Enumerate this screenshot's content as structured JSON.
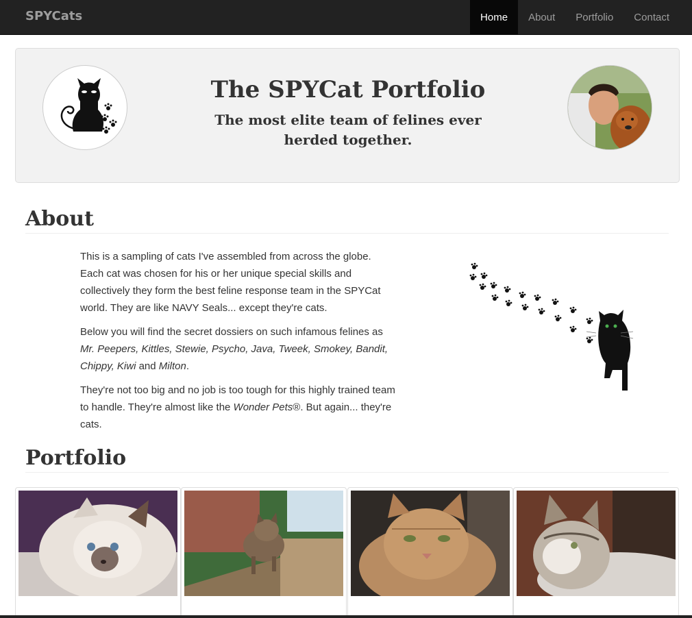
{
  "navbar": {
    "brand": "SPYCats",
    "items": [
      {
        "label": "Home",
        "active": true
      },
      {
        "label": "About",
        "active": false
      },
      {
        "label": "Portfolio",
        "active": false
      },
      {
        "label": "Contact",
        "active": false
      }
    ]
  },
  "header": {
    "title": "The SPYCat Portfolio",
    "subtitle": "The most elite team of felines ever herded together."
  },
  "about": {
    "heading": "About",
    "p1": "This is a sampling of cats I've assembled from across the globe. Each cat was chosen for his or her unique special skills and collectively they form the best feline response team in the SPYCat world. They are like NAVY Seals... except they're cats.",
    "p2_intro": "Below you will find the secret dossiers on such infamous felines as ",
    "p2_names": "Mr. Peepers, Kittles, Stewie, Psycho, Java, Tweek, Smokey, Bandit, Chippy, Kiwi",
    "p2_and": " and ",
    "p2_last": "Milton",
    "p2_end": ".",
    "p3_intro": "They're not too big and no job is too tough for this highly trained team to handle. They're almost like the ",
    "p3_em": "Wonder Pets",
    "p3_end": "®. But again... they're cats."
  },
  "portfolio": {
    "heading": "Portfolio"
  },
  "colors": {
    "navbar_bg": "#222222",
    "nav_active_bg": "#080808",
    "jumbotron_bg": "#f2f2f2",
    "text": "#333333"
  }
}
